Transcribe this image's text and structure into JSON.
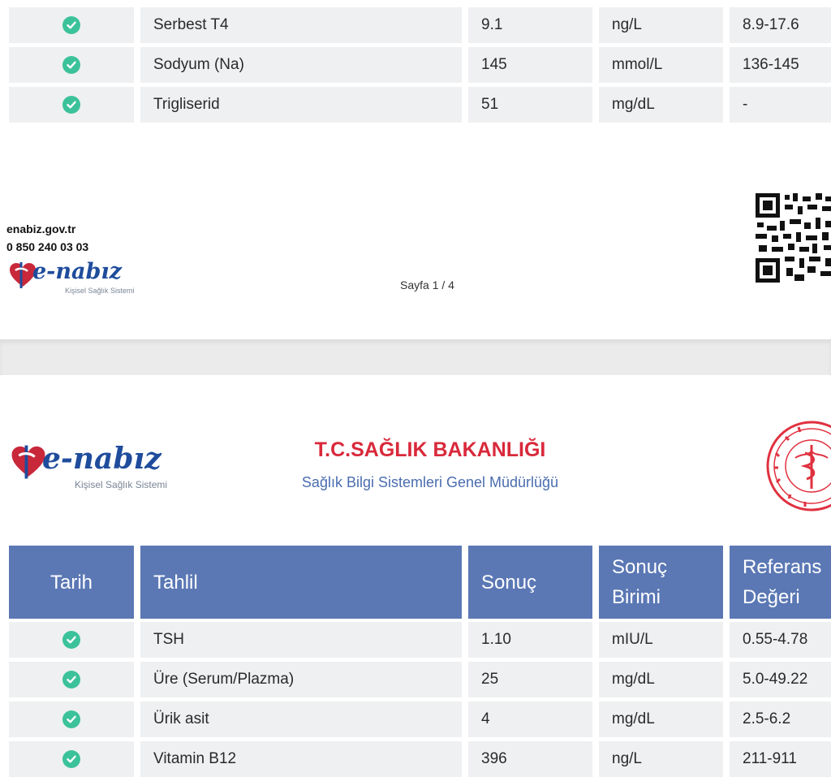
{
  "page1": {
    "rows": [
      {
        "test": "Serbest T4",
        "result": "9.1",
        "unit": "ng/L",
        "reference": "8.9-17.6"
      },
      {
        "test": "Sodyum (Na)",
        "result": "145",
        "unit": "mmol/L",
        "reference": "136-145"
      },
      {
        "test": "Trigliserid",
        "result": "51",
        "unit": "mg/dL",
        "reference": "-"
      }
    ],
    "footer": {
      "website": "enabiz.gov.tr",
      "phone": "0 850 240 03 03",
      "logo_text": "e-nabız",
      "logo_subtitle": "Kişisel Sağlık Sistemi",
      "page_label": "Sayfa 1 / 4"
    }
  },
  "page2": {
    "logo_text": "e-nabız",
    "logo_subtitle": "Kişisel Sağlık Sistemi",
    "ministry_title": "T.C.SAĞLIK BAKANLIĞI",
    "ministry_subtitle": "Sağlık Bilgi Sistemleri Genel Müdürlüğü",
    "headers": {
      "date": "Tarih",
      "test": "Tahlil",
      "result": "Sonuç",
      "unit_line1": "Sonuç",
      "unit_line2": "Birimi",
      "ref_line1": "Referans",
      "ref_line2": "Değeri"
    },
    "rows": [
      {
        "test": "TSH",
        "result": "1.10",
        "unit": "mIU/L",
        "reference": "0.55-4.78"
      },
      {
        "test": "Üre (Serum/Plazma)",
        "result": "25",
        "unit": "mg/dL",
        "reference": "5.0-49.22"
      },
      {
        "test": "Ürik asit",
        "result": "4",
        "unit": "mg/dL",
        "reference": "2.5-6.2"
      },
      {
        "test": "Vitamin B12",
        "result": "396",
        "unit": "ng/L",
        "reference": "211-911"
      }
    ]
  },
  "colors": {
    "header_bg": "#5b78b5",
    "cell_bg": "#eff0f2",
    "check_green": "#3cc29a",
    "ministry_red": "#d9293b",
    "ministry_blue": "#4a6db0",
    "logo_blue": "#1f4c9c"
  },
  "icons": {
    "status": "check-circle-icon",
    "logo": "heart-logo-icon",
    "qr": "qr-code-icon",
    "emblem": "ministry-emblem-icon"
  }
}
